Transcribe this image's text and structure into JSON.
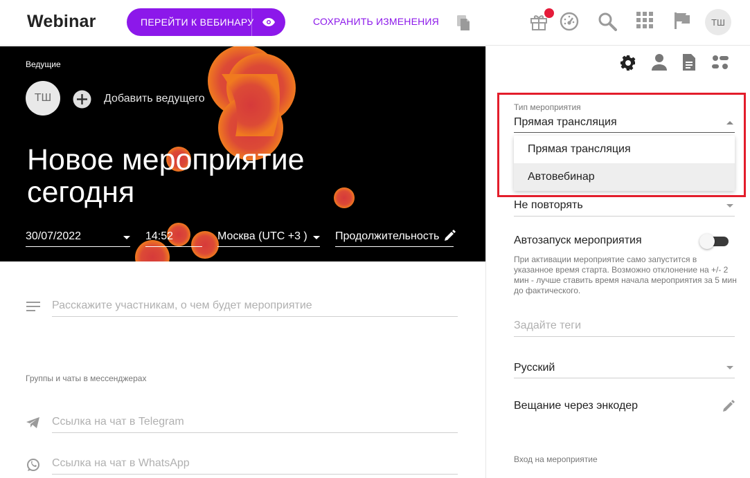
{
  "header": {
    "logo": "Webinar",
    "go_button_label": "ПЕРЕЙТИ К ВЕБИНАРУ",
    "save_label": "СОХРАНИТЬ ИЗМЕНЕНИЯ",
    "user_initials": "ТШ",
    "icons": [
      "copy-icon",
      "gift-icon",
      "dashboard-icon",
      "search-icon",
      "apps-icon",
      "flag-icon"
    ],
    "accent_color": "#8c18ea",
    "notification_color": "#e51b3a"
  },
  "hero": {
    "hosts_label": "Ведущие",
    "host_initials": "ТШ",
    "add_host_label": "Добавить ведущего",
    "title": "Новое мероприятие сегодня",
    "date": "30/07/2022",
    "time": "14:52",
    "timezone": "Москва (UTC +3 )",
    "duration_label": "Продолжительность"
  },
  "main": {
    "description_placeholder": "Расскажите участникам, о чем будет мероприятие",
    "groups_label": "Группы и чаты в мессенджерах",
    "telegram_placeholder": "Ссылка на чат в Telegram",
    "whatsapp_placeholder": "Ссылка на чат в WhatsApp"
  },
  "panel": {
    "tabs": [
      "settings-icon",
      "person-icon",
      "document-icon",
      "options-icon"
    ],
    "event_type_label": "Тип мероприятия",
    "event_type_value": "Прямая трансляция",
    "event_type_options": [
      "Прямая трансляция",
      "Автовебинар"
    ],
    "repeat_value": "Не повторять",
    "autostart_label": "Автозапуск мероприятия",
    "autostart_on": false,
    "autostart_help": "При активации мероприятие само запустится в указанное время старта. Возможно отклонение на +/- 2 мин - лучше ставить время начала мероприятия за 5 мин до фактического.",
    "tags_placeholder": "Задайте теги",
    "language_value": "Русский",
    "encoder_label": "Вещание через энкодер",
    "entry_label": "Вход на мероприятие",
    "highlight_color": "#e31d2b"
  }
}
